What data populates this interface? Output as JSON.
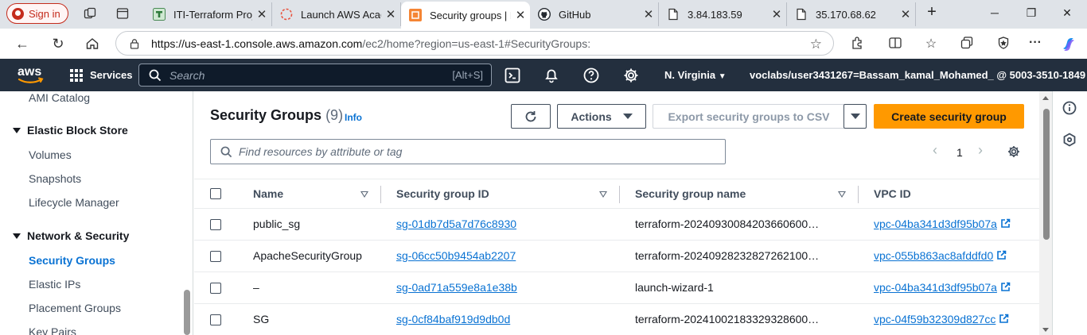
{
  "browser": {
    "signin_label": "Sign in",
    "tabs": [
      {
        "title": "ITI-Terraform Proje",
        "icon": "terraform-tab-icon"
      },
      {
        "title": "Launch AWS Acade",
        "icon": "loading-tab-icon"
      },
      {
        "title": "Security groups | EC",
        "icon": "aws-tab-icon"
      },
      {
        "title": "GitHub",
        "icon": "github-tab-icon"
      },
      {
        "title": "3.84.183.59",
        "icon": "page-tab-icon"
      },
      {
        "title": "35.170.68.62",
        "icon": "page-tab-icon"
      }
    ],
    "url_host": "https://us-east-1.console.aws.amazon.com",
    "url_rest": "/ec2/home?region=us-east-1#SecurityGroups:"
  },
  "aws_header": {
    "services_label": "Services",
    "search_placeholder": "Search",
    "search_shortcut": "[Alt+S]",
    "region": "N. Virginia",
    "account": "voclabs/user3431267=Bassam_kamal_Mohamed_ @ 5003-3510-1849"
  },
  "sidebar": {
    "top_item": "AMI Catalog",
    "sections": [
      {
        "label": "Elastic Block Store",
        "items": [
          "Volumes",
          "Snapshots",
          "Lifecycle Manager"
        ]
      },
      {
        "label": "Network & Security",
        "items": [
          "Security Groups",
          "Elastic IPs",
          "Placement Groups",
          "Key Pairs"
        ]
      }
    ],
    "active_item": "Security Groups"
  },
  "panel": {
    "title": "Security Groups",
    "count": "(9)",
    "info": "Info",
    "actions_label": "Actions",
    "export_label": "Export security groups to CSV",
    "create_label": "Create security group",
    "filter_placeholder": "Find resources by attribute or tag",
    "page": "1"
  },
  "table": {
    "columns": [
      "Name",
      "Security group ID",
      "Security group name",
      "VPC ID"
    ],
    "rows": [
      {
        "name": "public_sg",
        "id": "sg-01db7d5a7d76c8930",
        "group_name": "terraform-20240930084203660600…",
        "vpc": "vpc-04ba341d3df95b07a"
      },
      {
        "name": "ApacheSecurityGroup",
        "id": "sg-06cc50b9454ab2207",
        "group_name": "terraform-20240928232827262100…",
        "vpc": "vpc-055b863ac8afddfd0"
      },
      {
        "name": "–",
        "id": "sg-0ad71a559e8a1e38b",
        "group_name": "launch-wizard-1",
        "vpc": "vpc-04ba341d3df95b07a"
      },
      {
        "name": "SG",
        "id": "sg-0cf84baf919d9db0d",
        "group_name": "terraform-20241002183329328600…",
        "vpc": "vpc-04f59b32309d827cc"
      }
    ]
  },
  "colors": {
    "aws_header": "#232f3e",
    "aws_orange": "#ff9900",
    "link_blue": "#0972d3"
  }
}
